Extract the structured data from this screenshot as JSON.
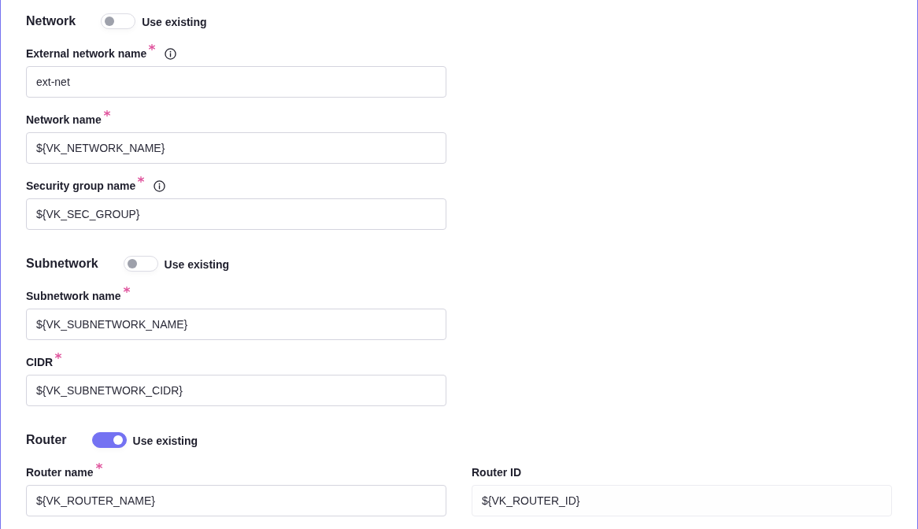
{
  "sections": [
    {
      "title": "Network",
      "use_existing": {
        "label": "Use existing",
        "on": false
      },
      "rows": [
        [
          {
            "label": "External network name",
            "required": true,
            "info": true,
            "value": "ext-net",
            "disabled": false
          }
        ],
        [
          {
            "label": "Network name",
            "required": true,
            "info": false,
            "value": "${VK_NETWORK_NAME}",
            "disabled": false
          }
        ],
        [
          {
            "label": "Security group name",
            "required": true,
            "info": true,
            "value": "${VK_SEC_GROUP}",
            "disabled": false
          }
        ]
      ]
    },
    {
      "title": "Subnetwork",
      "use_existing": {
        "label": "Use existing",
        "on": false
      },
      "rows": [
        [
          {
            "label": "Subnetwork name",
            "required": true,
            "info": false,
            "value": "${VK_SUBNETWORK_NAME}",
            "disabled": false
          }
        ],
        [
          {
            "label": "CIDR",
            "required": true,
            "info": false,
            "value": "${VK_SUBNETWORK_CIDR}",
            "disabled": false
          }
        ]
      ]
    },
    {
      "title": "Router",
      "use_existing": {
        "label": "Use existing",
        "on": true
      },
      "rows": [
        [
          {
            "label": "Router name",
            "required": true,
            "info": false,
            "value": "${VK_ROUTER_NAME}",
            "disabled": false
          },
          {
            "label": "Router ID",
            "required": false,
            "info": false,
            "value": "${VK_ROUTER_ID}",
            "disabled": true
          }
        ]
      ]
    }
  ]
}
